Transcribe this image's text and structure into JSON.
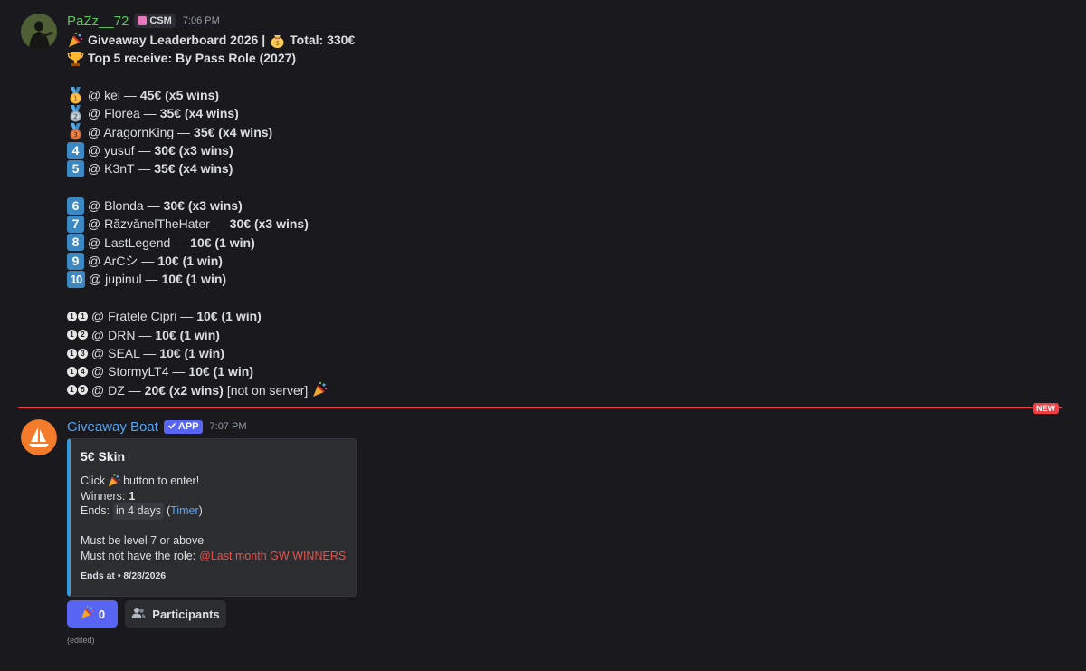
{
  "message1": {
    "username": "PaZz__72",
    "tag": "CSM",
    "time": "7:06 PM",
    "title_line": {
      "pre": "Giveaway Leaderboard 2026 |",
      "total": "Total: 330€"
    },
    "top5_line": "Top 5 receive: By Pass Role (2027)",
    "entries": [
      {
        "rank": "1",
        "name": "@ kel —",
        "prize": "45€ (x5 wins)",
        "extra": ""
      },
      {
        "rank": "2",
        "name": "@ Florea —",
        "prize": "35€ (x4 wins)",
        "extra": ""
      },
      {
        "rank": "3",
        "name": "@ AragornKing —",
        "prize": "35€ (x4 wins)",
        "extra": ""
      },
      {
        "rank": "4",
        "name": "@ yusuf —",
        "prize": "30€ (x3 wins)",
        "extra": ""
      },
      {
        "rank": "5",
        "name": "@ K3nT —",
        "prize": "35€ (x4 wins)",
        "extra": ""
      },
      {
        "rank": "6",
        "name": "@ Blonda —",
        "prize": "30€ (x3 wins)",
        "extra": ""
      },
      {
        "rank": "7",
        "name": "@ RăzvănelTheHater —",
        "prize": "30€ (x3 wins)",
        "extra": ""
      },
      {
        "rank": "8",
        "name": "@ LastLegend —",
        "prize": "10€ (1 win)",
        "extra": ""
      },
      {
        "rank": "9",
        "name": "@ ArCシ —",
        "prize": "10€ (1 win)",
        "extra": ""
      },
      {
        "rank": "10",
        "name": "@ jupinul —",
        "prize": "10€ (1 win)",
        "extra": ""
      },
      {
        "rank": "11",
        "name": "@ Fratele Cipri —",
        "prize": "10€ (1 win)",
        "extra": ""
      },
      {
        "rank": "12",
        "name": "@ DRN —",
        "prize": "10€ (1 win)",
        "extra": ""
      },
      {
        "rank": "13",
        "name": "@ SEAL —",
        "prize": "10€ (1 win)",
        "extra": ""
      },
      {
        "rank": "14",
        "name": "@ StormyLT4 —",
        "prize": "10€ (1 win)",
        "extra": ""
      },
      {
        "rank": "15",
        "name": "@ DZ —",
        "prize": "20€ (x2 wins)",
        "extra": "[not on server]"
      }
    ]
  },
  "divider": {
    "badge": "NEW"
  },
  "message2": {
    "username": "Giveaway Boat",
    "tag": "APP",
    "time": "7:07 PM",
    "embed": {
      "title": "5€ Skin",
      "click_pre": "Click",
      "click_post": "button to enter!",
      "winners_label": "Winners:",
      "winners_value": "1",
      "ends_label": "Ends:",
      "ends_value": "in 4 days",
      "timer_open": "(",
      "timer_link": "Timer",
      "timer_close": ")",
      "level_req": "Must be level 7 or above",
      "role_req": "Must not have the role:",
      "role_name": "@Last month GW WINNERS",
      "footer": "Ends at • 8/28/2026"
    },
    "buttons": {
      "enter_count": "0",
      "participants": "Participants"
    },
    "edited": "(edited)"
  },
  "colors": {
    "accent": "#5865f2",
    "embed_border": "#3498db",
    "new_red": "#f23f43",
    "role_red": "#e9524a"
  }
}
